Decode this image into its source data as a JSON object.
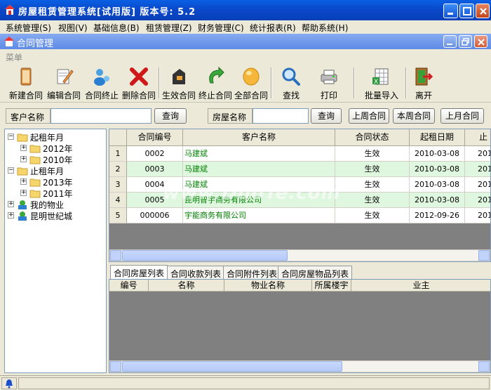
{
  "window": {
    "title": "房屋租赁管理系统[试用版]   版本号: 5.2"
  },
  "menubar": [
    "系统管理(S)",
    "视图(V)",
    "基础信息(B)",
    "租赁管理(Z)",
    "财务管理(C)",
    "统计报表(R)",
    "帮助系统(H)"
  ],
  "inner": {
    "title": "合同管理",
    "menu_label": "菜单"
  },
  "toolbar": [
    {
      "label": "新建合同",
      "icon": "new-contract-icon"
    },
    {
      "label": "编辑合同",
      "icon": "edit-contract-icon"
    },
    {
      "label": "合同终止",
      "icon": "terminate-contract-icon"
    },
    {
      "label": "删除合同",
      "icon": "delete-icon"
    },
    {
      "label": "生效合同",
      "icon": "active-contract-icon"
    },
    {
      "label": "终止合同",
      "icon": "ended-contract-icon"
    },
    {
      "label": "全部合同",
      "icon": "all-contracts-icon"
    },
    {
      "label": "查找",
      "icon": "search-icon"
    },
    {
      "label": "打印",
      "icon": "printer-icon"
    },
    {
      "label": "批量导入",
      "icon": "import-icon"
    },
    {
      "label": "离开",
      "icon": "exit-icon"
    }
  ],
  "search": {
    "customer_label": "客户名称",
    "customer_value": "",
    "query1": "查询",
    "house_label": "房屋名称",
    "house_value": "",
    "query2": "查询",
    "last_week": "上周合同",
    "this_week": "本周合同",
    "last_month": "上月合同"
  },
  "tree": [
    {
      "label": "起租年月",
      "level": 0,
      "expanded": true,
      "icon": "folder-icon"
    },
    {
      "label": "2012年",
      "level": 1,
      "expanded": false,
      "icon": "folder-icon"
    },
    {
      "label": "2010年",
      "level": 1,
      "expanded": false,
      "icon": "folder-icon"
    },
    {
      "label": "止租年月",
      "level": 0,
      "expanded": true,
      "icon": "folder-icon"
    },
    {
      "label": "2013年",
      "level": 1,
      "expanded": false,
      "icon": "folder-icon"
    },
    {
      "label": "2011年",
      "level": 1,
      "expanded": false,
      "icon": "folder-icon"
    },
    {
      "label": "我的物业",
      "level": 0,
      "expanded": false,
      "icon": "property-icon"
    },
    {
      "label": "昆明世纪城",
      "level": 0,
      "expanded": false,
      "icon": "property-icon"
    }
  ],
  "grid": {
    "columns": [
      "合同编号",
      "客户名称",
      "合同状态",
      "起租日期",
      "止"
    ],
    "rows": [
      {
        "n": "1",
        "id": "0002",
        "customer": "马建斌",
        "status": "生效",
        "start": "2010-03-08",
        "end": "201"
      },
      {
        "n": "2",
        "id": "0003",
        "customer": "马建斌",
        "status": "生效",
        "start": "2010-03-08",
        "end": "201"
      },
      {
        "n": "3",
        "id": "0004",
        "customer": "马建斌",
        "status": "生效",
        "start": "2010-03-08",
        "end": "201"
      },
      {
        "n": "4",
        "id": "0005",
        "customer": "昆明智宇商务有限公司",
        "status": "生效",
        "start": "2010-03-08",
        "end": "201"
      },
      {
        "n": "5",
        "id": "000006",
        "customer": "宇能商务有限公司",
        "status": "生效",
        "start": "2012-09-26",
        "end": "201"
      }
    ]
  },
  "tabs": [
    "合同房屋列表",
    "合同收款列表",
    "合同附件列表",
    "合同房屋物品列表"
  ],
  "subgrid": {
    "columns": [
      "编号",
      "名称",
      "物业名称",
      "所属楼宇",
      "业主"
    ]
  },
  "watermark": "www.DuoTe.com",
  "colors": {
    "title_blue": "#0a47c8",
    "row_green": "#dff7df",
    "customer_text": "#008000"
  }
}
